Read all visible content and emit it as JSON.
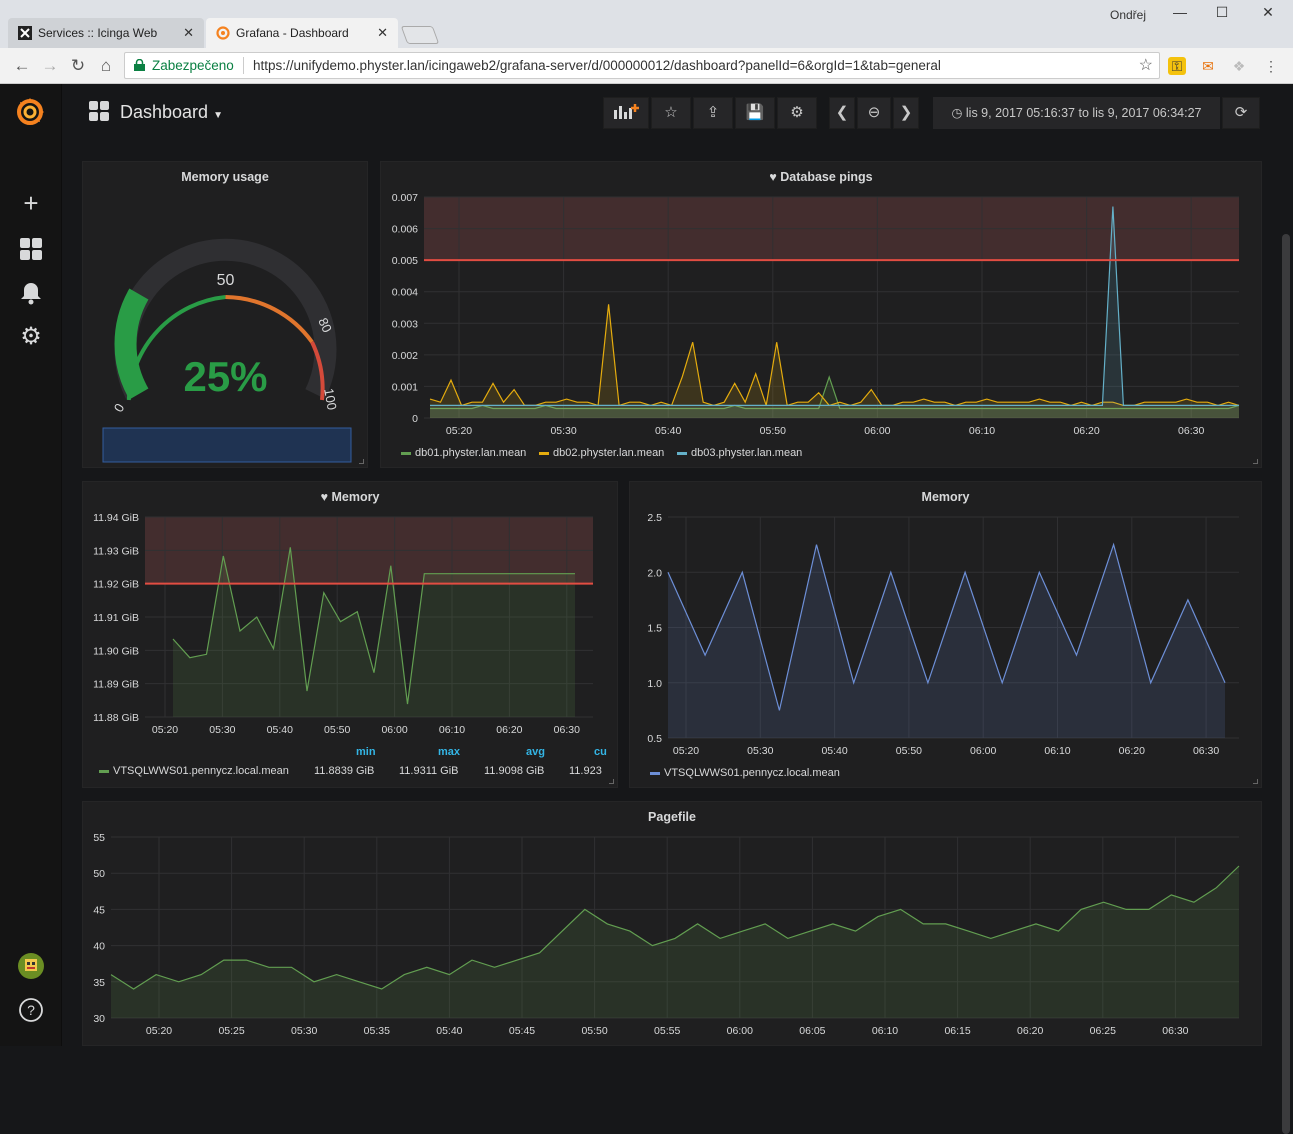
{
  "browser": {
    "tabs": [
      {
        "label": "Services :: Icinga Web",
        "active": false
      },
      {
        "label": "Grafana - Dashboard",
        "active": true
      }
    ],
    "user": "Ondřej",
    "security_label": "Zabezpečeno",
    "url": "https://unifydemo.physter.lan/icingaweb2/grafana-server/d/000000012/dashboard?panelId=6&orgId=1&tab=general"
  },
  "grafana": {
    "dashboard_title": "Dashboard",
    "time_range": "lis 9, 2017 05:16:37 to lis 9, 2017 06:34:27",
    "colors": {
      "green": "#629e51",
      "yellow": "#e5ac0e",
      "cyan": "#64b0c8",
      "blue": "#6d8fd7",
      "threshold": "#e24d42",
      "gauge_green": "#299c46"
    }
  },
  "panels": {
    "memory_usage": {
      "title": "Memory usage",
      "value": "25%",
      "gauge_percent": 25,
      "tick_0": "0",
      "tick_50": "50",
      "tick_80": "80",
      "tick_100": "100"
    },
    "db_pings": {
      "title": "Database pings",
      "legend": [
        "db01.physter.lan.mean",
        "db02.physter.lan.mean",
        "db03.physter.lan.mean"
      ]
    },
    "memory_left": {
      "title": "Memory",
      "legend_name": "VTSQLWWS01.pennycz.local.mean",
      "headers": {
        "min": "min",
        "max": "max",
        "avg": "avg",
        "cur": "cu"
      },
      "values": {
        "min": "11.8839 GiB",
        "max": "11.9311 GiB",
        "avg": "11.9098 GiB",
        "cur": "11.923"
      }
    },
    "memory_right": {
      "title": "Memory",
      "legend_name": "VTSQLWWS01.pennycz.local.mean"
    },
    "pagefile": {
      "title": "Pagefile"
    }
  },
  "chart_data": [
    {
      "type": "line",
      "title": "Database pings",
      "x": [
        "05:17",
        "05:18",
        "05:19",
        "05:20",
        "05:21",
        "05:22",
        "05:23",
        "05:24",
        "05:25",
        "05:26",
        "05:27",
        "05:28",
        "05:29",
        "05:30",
        "05:31",
        "05:32",
        "05:33",
        "05:34",
        "05:35",
        "05:36",
        "05:37",
        "05:38",
        "05:39",
        "05:40",
        "05:41",
        "05:42",
        "05:43",
        "05:44",
        "05:45",
        "05:46",
        "05:47",
        "05:48",
        "05:49",
        "05:50",
        "05:51",
        "05:52",
        "05:53",
        "05:54",
        "05:55",
        "05:56",
        "05:57",
        "05:58",
        "05:59",
        "06:00",
        "06:01",
        "06:02",
        "06:03",
        "06:04",
        "06:05",
        "06:06",
        "06:07",
        "06:08",
        "06:09",
        "06:10",
        "06:11",
        "06:12",
        "06:13",
        "06:14",
        "06:15",
        "06:16",
        "06:17",
        "06:18",
        "06:19",
        "06:20",
        "06:21",
        "06:22",
        "06:23",
        "06:24",
        "06:25",
        "06:26",
        "06:27",
        "06:28",
        "06:29",
        "06:30",
        "06:31",
        "06:32",
        "06:33",
        "06:34"
      ],
      "series": [
        {
          "name": "db01.physter.lan.mean",
          "values": [
            0.0003,
            0.0003,
            0.0003,
            0.0003,
            0.0003,
            0.0004,
            0.0003,
            0.0003,
            0.0003,
            0.0003,
            0.0003,
            0.0004,
            0.0003,
            0.0003,
            0.0003,
            0.0003,
            0.0003,
            0.0003,
            0.0003,
            0.0003,
            0.0003,
            0.0003,
            0.0003,
            0.0003,
            0.0003,
            0.0003,
            0.0003,
            0.0003,
            0.0003,
            0.0004,
            0.0003,
            0.0003,
            0.0003,
            0.0003,
            0.0003,
            0.0003,
            0.0003,
            0.0003,
            0.0013,
            0.0003,
            0.0003,
            0.0003,
            0.0003,
            0.0003,
            0.0003,
            0.0003,
            0.0003,
            0.0003,
            0.0003,
            0.0003,
            0.0003,
            0.0003,
            0.0003,
            0.0003,
            0.0003,
            0.0003,
            0.0003,
            0.0003,
            0.0003,
            0.0003,
            0.0003,
            0.0003,
            0.0003,
            0.0003,
            0.0003,
            0.0003,
            0.0003,
            0.0003,
            0.0003,
            0.0003,
            0.0003,
            0.0003,
            0.0003,
            0.0003,
            0.0003,
            0.0003,
            0.0003,
            0.0004
          ]
        },
        {
          "name": "db02.physter.lan.mean",
          "values": [
            0.0006,
            0.0005,
            0.0012,
            0.0004,
            0.0005,
            0.0005,
            0.0011,
            0.0005,
            0.0009,
            0.0004,
            0.0004,
            0.0005,
            0.0005,
            0.0006,
            0.0005,
            0.0005,
            0.0004,
            0.0036,
            0.0004,
            0.0005,
            0.0005,
            0.0004,
            0.0005,
            0.0004,
            0.0013,
            0.0024,
            0.0005,
            0.0004,
            0.0005,
            0.0011,
            0.0005,
            0.0014,
            0.0004,
            0.0024,
            0.0004,
            0.0005,
            0.0005,
            0.0008,
            0.0004,
            0.0005,
            0.0004,
            0.0005,
            0.0009,
            0.0004,
            0.0004,
            0.0005,
            0.0005,
            0.0006,
            0.0005,
            0.0005,
            0.0004,
            0.0005,
            0.0005,
            0.0006,
            0.0005,
            0.0005,
            0.0005,
            0.0005,
            0.0006,
            0.0005,
            0.0005,
            0.0004,
            0.0005,
            0.0004,
            0.0005,
            0.0005,
            0.0004,
            0.0004,
            0.0005,
            0.0005,
            0.0005,
            0.0005,
            0.0006,
            0.0005,
            0.0005,
            0.0004,
            0.0005,
            0.0004
          ]
        },
        {
          "name": "db03.physter.lan.mean",
          "values": [
            0.0004,
            0.0004,
            0.0004,
            0.0004,
            0.0004,
            0.0004,
            0.0004,
            0.0004,
            0.0004,
            0.0004,
            0.0004,
            0.0004,
            0.0004,
            0.0004,
            0.0004,
            0.0004,
            0.0004,
            0.0004,
            0.0004,
            0.0004,
            0.0004,
            0.0004,
            0.0004,
            0.0004,
            0.0004,
            0.0004,
            0.0004,
            0.0004,
            0.0004,
            0.0004,
            0.0004,
            0.0004,
            0.0004,
            0.0004,
            0.0004,
            0.0004,
            0.0004,
            0.0004,
            0.0004,
            0.0004,
            0.0004,
            0.0004,
            0.0004,
            0.0004,
            0.0004,
            0.0004,
            0.0004,
            0.0004,
            0.0004,
            0.0004,
            0.0004,
            0.0004,
            0.0004,
            0.0004,
            0.0004,
            0.0004,
            0.0004,
            0.0004,
            0.0004,
            0.0004,
            0.0004,
            0.0004,
            0.0004,
            0.0004,
            0.0004,
            0.0067,
            0.0004,
            0.0004,
            0.0004,
            0.0004,
            0.0004,
            0.0004,
            0.0004,
            0.0004,
            0.0004,
            0.0004,
            0.0004,
            0.0004
          ]
        }
      ],
      "x_ticks": [
        "05:20",
        "05:30",
        "05:40",
        "05:50",
        "06:00",
        "06:10",
        "06:20",
        "06:30"
      ],
      "y_ticks": [
        "0",
        "0.001",
        "0.002",
        "0.003",
        "0.004",
        "0.005",
        "0.006",
        "0.007"
      ],
      "ylim": [
        0,
        0.007
      ],
      "threshold": 0.005
    },
    {
      "type": "area",
      "title": "Memory",
      "x": [
        "05:21",
        "05:24",
        "05:27",
        "05:30",
        "05:33",
        "05:36",
        "05:39",
        "05:42",
        "05:45",
        "05:48",
        "05:51",
        "05:54",
        "05:57",
        "06:00",
        "06:03",
        "06:06",
        "06:09",
        "06:12",
        "06:15",
        "06:18",
        "06:21",
        "06:24",
        "06:27",
        "06:30",
        "06:31"
      ],
      "series": [
        {
          "name": "VTSQLWWS01.pennycz.local.mean",
          "values": [
            11.9034,
            11.8978,
            11.8988,
            11.9283,
            11.9058,
            11.91,
            11.9005,
            11.9309,
            11.8878,
            11.9173,
            11.9086,
            11.9116,
            11.8933,
            11.9254,
            11.8839,
            11.923,
            11.923,
            11.923,
            11.923,
            11.923,
            11.923,
            11.923,
            11.923,
            11.923,
            11.923
          ]
        }
      ],
      "x_ticks": [
        "05:20",
        "05:30",
        "05:40",
        "05:50",
        "06:00",
        "06:10",
        "06:20",
        "06:30"
      ],
      "y_ticks": [
        "11.88 GiB",
        "11.89 GiB",
        "11.90 GiB",
        "11.91 GiB",
        "11.92 GiB",
        "11.93 GiB",
        "11.94 GiB"
      ],
      "ylim": [
        11.88,
        11.94
      ],
      "threshold": 11.92
    },
    {
      "type": "area",
      "title": "Memory",
      "x": [
        "05:18",
        "05:22",
        "05:26",
        "05:30",
        "05:34",
        "05:38",
        "05:42",
        "05:46",
        "05:50",
        "05:54",
        "05:58",
        "06:02",
        "06:06",
        "06:10",
        "06:14",
        "06:18",
        "06:22",
        "06:26",
        "06:30",
        "06:34"
      ],
      "series": [
        {
          "name": "VTSQLWWS01.pennycz.local.mean",
          "values": [
            2.0,
            1.25,
            2.0,
            0.75,
            2.25,
            1.0,
            2.0,
            1.0,
            2.0,
            1.0,
            2.0,
            1.25,
            2.25,
            1.0,
            1.75,
            1.0
          ]
        }
      ],
      "x_ticks": [
        "05:20",
        "05:30",
        "05:40",
        "05:50",
        "06:00",
        "06:10",
        "06:20",
        "06:30"
      ],
      "y_ticks": [
        "0.5",
        "1.0",
        "1.5",
        "2.0",
        "2.5"
      ],
      "ylim": [
        0.5,
        2.5
      ]
    },
    {
      "type": "area",
      "title": "Pagefile",
      "series": [
        {
          "name": "Pagefile",
          "values": [
            36,
            34,
            36,
            35,
            36,
            38,
            38,
            37,
            37,
            35,
            36,
            35,
            34,
            36,
            37,
            36,
            38,
            37,
            38,
            39,
            42,
            45,
            43,
            42,
            40,
            41,
            43,
            41,
            42,
            43,
            41,
            42,
            43,
            42,
            44,
            45,
            43,
            43,
            42,
            41,
            42,
            43,
            42,
            45,
            46,
            45,
            45,
            47,
            46,
            48,
            51
          ]
        }
      ],
      "x_ticks": [
        "05:20",
        "05:25",
        "05:30",
        "05:35",
        "05:40",
        "05:45",
        "05:50",
        "05:55",
        "06:00",
        "06:05",
        "06:10",
        "06:15",
        "06:20",
        "06:25",
        "06:30"
      ],
      "y_ticks": [
        "30",
        "35",
        "40",
        "45",
        "50",
        "55"
      ],
      "ylim": [
        30,
        55
      ]
    }
  ]
}
